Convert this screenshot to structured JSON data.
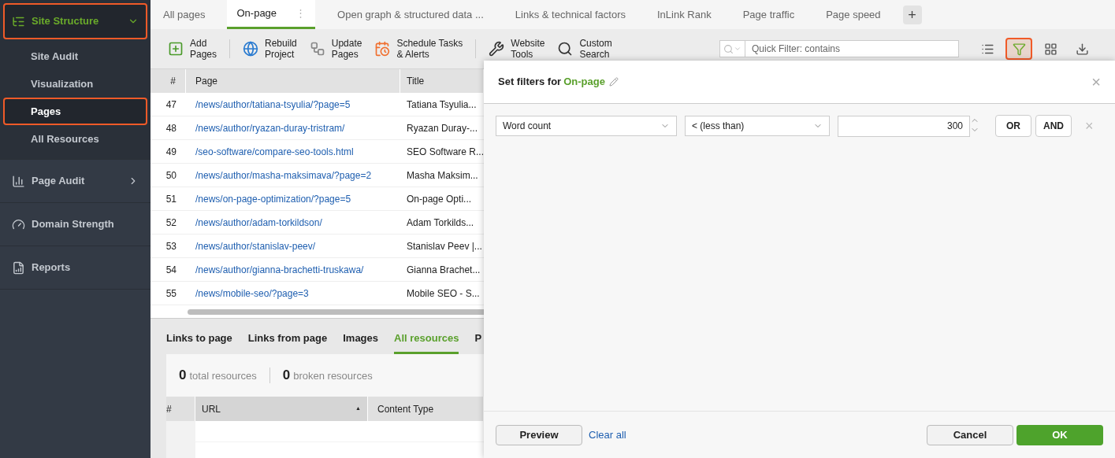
{
  "sidebar": {
    "sections": [
      {
        "label": "Site Structure",
        "expanded": true,
        "highlighted": true,
        "active": true,
        "children": [
          {
            "label": "Site Audit",
            "selected": false,
            "highlighted": false
          },
          {
            "label": "Visualization",
            "selected": false,
            "highlighted": false
          },
          {
            "label": "Pages",
            "selected": true,
            "highlighted": true
          },
          {
            "label": "All Resources",
            "selected": false,
            "highlighted": false
          }
        ]
      },
      {
        "label": "Page Audit",
        "expanded": false,
        "highlighted": false,
        "active": false
      },
      {
        "label": "Domain Strength",
        "highlighted": false,
        "active": false
      },
      {
        "label": "Reports",
        "highlighted": false,
        "active": false
      }
    ]
  },
  "tabs": [
    {
      "label": "All pages",
      "selected": false
    },
    {
      "label": "On-page",
      "selected": true,
      "menu": "⋮"
    },
    {
      "label": "Open graph & structured data ...",
      "selected": false
    },
    {
      "label": "Links & technical factors",
      "selected": false
    },
    {
      "label": "InLink Rank",
      "selected": false
    },
    {
      "label": "Page traffic",
      "selected": false
    },
    {
      "label": "Page speed",
      "selected": false
    }
  ],
  "add_tab": "+",
  "toolbar": [
    {
      "label": "Add\nPages"
    },
    {
      "label": "Rebuild\nProject"
    },
    {
      "label": "Update\nPages"
    },
    {
      "label": "Schedule Tasks\n& Alerts"
    },
    {
      "label": "Website\nTools"
    },
    {
      "label": "Custom\nSearch"
    }
  ],
  "quick_filter": {
    "placeholder": "Quick Filter: contains"
  },
  "view_buttons": [
    {
      "highlighted": false
    },
    {
      "highlighted": true
    },
    {
      "highlighted": false
    },
    {
      "highlighted": false
    }
  ],
  "table": {
    "columns": [
      "#",
      "Page",
      "Title"
    ],
    "rows": [
      [
        "47",
        "/news/author/tatiana-tsyulia/?page=5",
        "Tatiana Tsyulia..."
      ],
      [
        "48",
        "/news/author/ryazan-duray-tristram/",
        "Ryazan Duray-..."
      ],
      [
        "49",
        "/seo-software/compare-seo-tools.html",
        "SEO Software R..."
      ],
      [
        "50",
        "/news/author/masha-maksimava/?page=2",
        "Masha Maksim..."
      ],
      [
        "51",
        "/news/on-page-optimization/?page=5",
        "On-page Opti..."
      ],
      [
        "52",
        "/news/author/adam-torkildson/",
        "Adam Torkilds..."
      ],
      [
        "53",
        "/news/author/stanislav-peev/",
        "Stanislav Peev |..."
      ],
      [
        "54",
        "/news/author/gianna-brachetti-truskawa/",
        "Gianna Brachet..."
      ],
      [
        "55",
        "/news/mobile-seo/?page=3",
        "Mobile SEO - S..."
      ]
    ]
  },
  "bottom_tabs": [
    {
      "label": "Links to page",
      "selected": false
    },
    {
      "label": "Links from page",
      "selected": false
    },
    {
      "label": "Images",
      "selected": false
    },
    {
      "label": "All resources",
      "selected": true
    },
    {
      "label": "P",
      "selected": false
    }
  ],
  "summary": [
    {
      "count": "0",
      "label": "total resources"
    },
    {
      "count": "0",
      "label": "broken resources"
    }
  ],
  "resources_table": {
    "columns": [
      {
        "label": "#"
      },
      {
        "label": "URL",
        "sort_indicator": "▲"
      },
      {
        "label": "Content Type"
      }
    ]
  },
  "filter_dialog": {
    "title": "Set filters for",
    "target": "On-page",
    "close": "×",
    "conditions": [
      {
        "field": "Word count",
        "operator": "< (less than)",
        "value": "300",
        "or": "OR",
        "and": "AND",
        "remove": "×"
      }
    ],
    "preview": "Preview",
    "clear": "Clear all",
    "cancel": "Cancel",
    "ok": "OK"
  }
}
